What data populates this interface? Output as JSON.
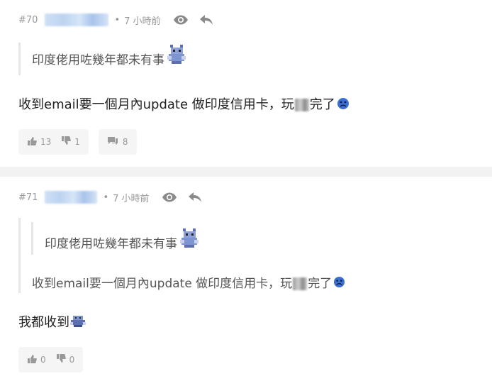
{
  "posts": [
    {
      "number": "#70",
      "separator": "•",
      "time": "7 小時前",
      "quote": {
        "text": "印度佬用咗幾年都未有事"
      },
      "body": {
        "before_blur": "收到email要一個月內update 做印度信用卡，玩",
        "after_blur": "完了"
      },
      "upvotes": "13",
      "downvotes": "1",
      "replies": "8"
    },
    {
      "number": "#71",
      "separator": "•",
      "time": "7 小時前",
      "nested_quote": {
        "text": "印度佬用咗幾年都未有事"
      },
      "quote": {
        "before_blur": "收到email要一個月內update 做印度信用卡，玩",
        "after_blur": "完了"
      },
      "body": {
        "text": "我都收到"
      },
      "upvotes": "0",
      "downvotes": "0"
    }
  ],
  "icons": {
    "view": "eye-icon",
    "reply": "reply-arrow-icon",
    "upvote": "thumb-up-icon",
    "downvote": "thumb-down-icon",
    "comment": "comment-bubble-icon",
    "sticker": "pixel-dragon-sticker",
    "emoji": "sad-face-icon"
  },
  "colors": {
    "meta_text": "#999999",
    "quote_border": "#e6e6e6",
    "divider": "#f2f2f2",
    "sticker": "#7f95cf",
    "sad_face": "#3b6fd1"
  }
}
